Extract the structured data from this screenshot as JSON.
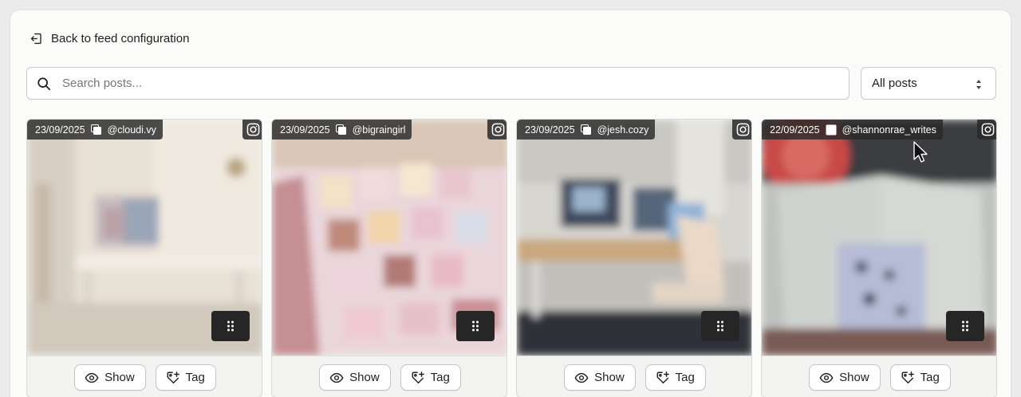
{
  "nav": {
    "back_label": "Back to feed configuration"
  },
  "search": {
    "placeholder": "Search posts...",
    "value": ""
  },
  "filter": {
    "selected": "All posts"
  },
  "colors": {
    "accent": "#262626",
    "overlay": "#282828",
    "card_bg": "#f3f4f1"
  },
  "posts": [
    {
      "date": "23/09/2025",
      "username": "@cloudi.vy",
      "media_icon": "carousel-icon",
      "platform_icon": "instagram-icon",
      "show_label": "Show",
      "tag_label": "Tag"
    },
    {
      "date": "23/09/2025",
      "username": "@bigraingirl",
      "media_icon": "carousel-icon",
      "platform_icon": "instagram-icon",
      "show_label": "Show",
      "tag_label": "Tag"
    },
    {
      "date": "23/09/2025",
      "username": "@jesh.cozy",
      "media_icon": "carousel-icon",
      "platform_icon": "instagram-icon",
      "show_label": "Show",
      "tag_label": "Tag"
    },
    {
      "date": "22/09/2025",
      "username": "@shannonrae_writes",
      "media_icon": "image-icon",
      "platform_icon": "instagram-icon",
      "show_label": "Show",
      "tag_label": "Tag"
    }
  ]
}
